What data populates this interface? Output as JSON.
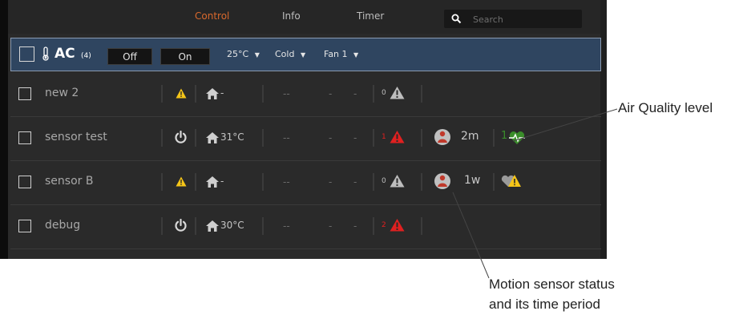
{
  "nav": {
    "tabs": [
      {
        "label": "Control",
        "active": true
      },
      {
        "label": "Info",
        "active": false
      },
      {
        "label": "Timer",
        "active": false
      }
    ],
    "search_placeholder": "Search"
  },
  "group": {
    "name": "AC",
    "count": "(4)",
    "off_label": "Off",
    "on_label": "On",
    "temperature": "25°C",
    "mode": "Cold",
    "fan": "Fan 1"
  },
  "devices": [
    {
      "name": "new 2",
      "status": "warning",
      "temp": "-",
      "dashes": [
        "--",
        "-",
        "-"
      ],
      "alarm_count": "0",
      "alarm_color": "#bdbdbd",
      "motion": null,
      "air_quality": null
    },
    {
      "name": "sensor test",
      "status": "power",
      "temp": "31°C",
      "dashes": [
        "--",
        "-",
        "-"
      ],
      "alarm_count": "1",
      "alarm_color": "#e02020",
      "motion": {
        "time": "2m"
      },
      "air_quality": {
        "level": "1",
        "state": "good"
      }
    },
    {
      "name": "sensor B",
      "status": "warning",
      "temp": "-",
      "dashes": [
        "--",
        "-",
        "-"
      ],
      "alarm_count": "0",
      "alarm_color": "#bdbdbd",
      "motion": {
        "time": "1w"
      },
      "air_quality": {
        "level": null,
        "state": "warning"
      }
    },
    {
      "name": "debug",
      "status": "power",
      "temp": "30°C",
      "dashes": [
        "--",
        "-",
        "-"
      ],
      "alarm_count": "2",
      "alarm_color": "#e02020",
      "motion": null,
      "air_quality": null
    }
  ],
  "annotations": {
    "air_quality": "Air Quality level",
    "motion_line1": "Motion sensor status",
    "motion_line2": "and its time period"
  },
  "colors": {
    "accent": "#d9692d",
    "warning": "#f5c518",
    "alarm": "#e02020",
    "air_quality_good": "#3a8d2a"
  }
}
